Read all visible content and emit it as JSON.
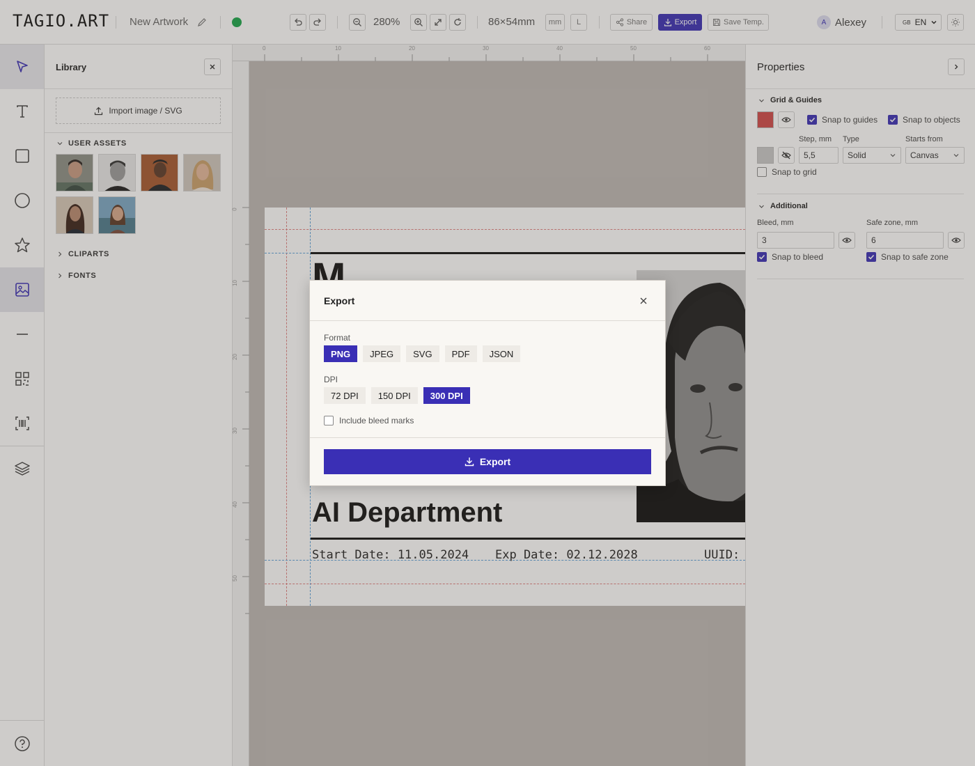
{
  "app": {
    "logo": "TAGIO.ART",
    "artwork_name": "New Artwork",
    "status_color": "#1aa64a",
    "accent_color": "#3a2fb5"
  },
  "toolbar": {
    "zoom": "280%",
    "size": "86×54mm",
    "unit": "mm",
    "orientation": "L",
    "share_label": "Share",
    "export_label": "Export",
    "save_template_label": "Save Temp.",
    "user_initial": "A",
    "user_name": "Alexey",
    "lang_flag": "GB",
    "lang": "EN"
  },
  "rail": {
    "items": [
      "select-tool",
      "text-tool",
      "rectangle-tool",
      "ellipse-tool",
      "star-tool",
      "image-tool",
      "line-tool",
      "qr-code-tool",
      "barcode-tool",
      "layers"
    ],
    "active": "image-tool",
    "help": "help"
  },
  "library": {
    "title": "Library",
    "import_label": "Import image / SVG",
    "user_assets_label": "USER ASSETS",
    "cliparts_label": "CLIPARTS",
    "fonts_label": "FONTS",
    "asset_count": 6
  },
  "ruler": {
    "top_ticks": [
      "0",
      "10",
      "20",
      "30",
      "40",
      "50",
      "60"
    ],
    "left_ticks": [
      "0",
      "10",
      "20",
      "30",
      "40",
      "50"
    ]
  },
  "card": {
    "headline_partial": "M",
    "department": "AI Department",
    "start_date": "Start Date: 11.05.2024",
    "exp_date": "Exp Date: 02.12.2028",
    "uuid_label": "UUID:"
  },
  "properties": {
    "title": "Properties",
    "grid_section": "Grid & Guides",
    "guide_color": "#d04848",
    "grid_color": "#c8c8c8",
    "snap_to_guides": "Snap to guides",
    "snap_to_objects": "Snap to objects",
    "step_label": "Step, mm",
    "step_value": "5,5",
    "type_label": "Type",
    "type_value": "Solid",
    "starts_label": "Starts from",
    "starts_value": "Canvas",
    "snap_to_grid": "Snap to grid",
    "additional_section": "Additional",
    "bleed_label": "Bleed, mm",
    "bleed_value": "3",
    "safe_label": "Safe zone, mm",
    "safe_value": "6",
    "snap_to_bleed": "Snap to bleed",
    "snap_to_safe": "Snap to safe zone"
  },
  "modal": {
    "title": "Export",
    "format_label": "Format",
    "formats": [
      "PNG",
      "JPEG",
      "SVG",
      "PDF",
      "JSON"
    ],
    "selected_format": "PNG",
    "dpi_label": "DPI",
    "dpis": [
      "72 DPI",
      "150 DPI",
      "300 DPI"
    ],
    "selected_dpi": "300 DPI",
    "bleed_marks_label": "Include bleed marks",
    "export_button": "Export"
  }
}
